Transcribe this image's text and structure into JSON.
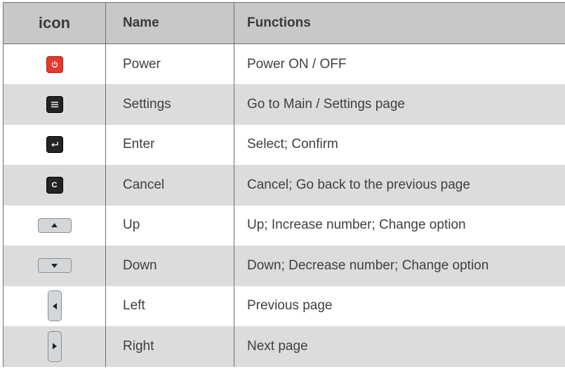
{
  "header": {
    "icon": "icon",
    "name": "Name",
    "functions": "Functions"
  },
  "rows": [
    {
      "icon": "power-icon",
      "name": "Power",
      "function": "Power ON / OFF"
    },
    {
      "icon": "menu-icon",
      "name": "Settings",
      "function": "Go to Main / Settings page"
    },
    {
      "icon": "enter-icon",
      "name": "Enter",
      "function": "Select; Confirm"
    },
    {
      "icon": "cancel-icon",
      "icon_letter": "C",
      "name": "Cancel",
      "function": "Cancel; Go back to the previous page"
    },
    {
      "icon": "up-arrow-icon",
      "name": "Up",
      "function": "Up; Increase number; Change option"
    },
    {
      "icon": "down-arrow-icon",
      "name": "Down",
      "function": "Down; Decrease number; Change option"
    },
    {
      "icon": "left-arrow-icon",
      "name": "Left",
      "function": "Previous page"
    },
    {
      "icon": "right-arrow-icon",
      "name": "Right",
      "function": "Next page"
    }
  ],
  "colors": {
    "header_bg": "#c8c8c8",
    "stripe_bg": "#dcdcdc",
    "power_button": "#e23b2e",
    "dark_button": "#222426",
    "arrow_button": "#d4d7d9"
  }
}
